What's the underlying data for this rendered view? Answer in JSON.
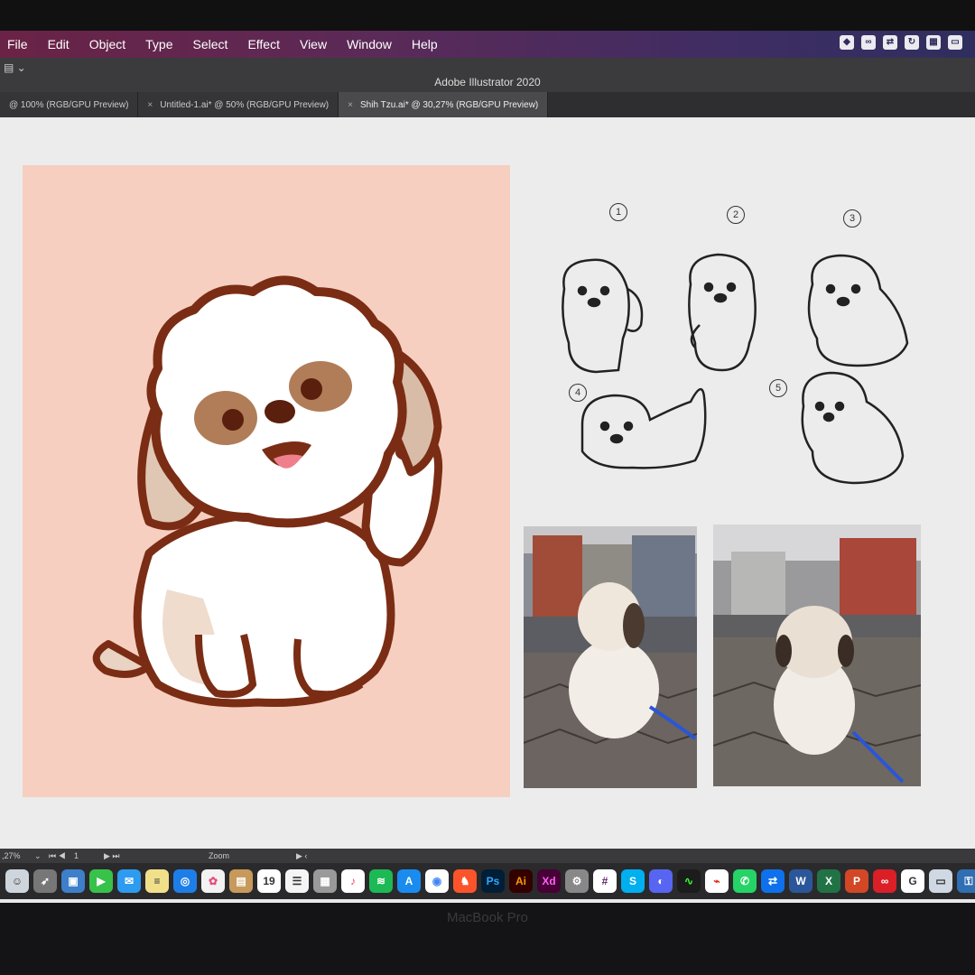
{
  "menu": {
    "items": [
      "File",
      "Edit",
      "Object",
      "Type",
      "Select",
      "Effect",
      "View",
      "Window",
      "Help"
    ],
    "tray_icons": [
      "dropbox-icon",
      "creative-cloud-icon",
      "teamviewer-icon",
      "sync-icon",
      "grid-icon",
      "display-icon"
    ]
  },
  "window": {
    "app_title": "Adobe Illustrator 2020"
  },
  "tabs": [
    {
      "label": "@ 100% (RGB/GPU Preview)",
      "active": false
    },
    {
      "label": "Untitled-1.ai* @ 50% (RGB/GPU Preview)",
      "active": false
    },
    {
      "label": "Shih Tzu.ai* @ 30,27% (RGB/GPU Preview)",
      "active": true
    }
  ],
  "sketches": {
    "numbers": [
      "1",
      "2",
      "3",
      "4",
      "5"
    ]
  },
  "statusbar": {
    "zoom_value": ",27%",
    "page_value": "1",
    "zoom_label": "Zoom"
  },
  "dock": {
    "calendar_day": "19",
    "labels": {
      "ps": "Ps",
      "ai": "Ai",
      "xd": "Xd"
    }
  },
  "device": {
    "brand": "MacBook Pro"
  },
  "colors": {
    "artboard": "#f6cfc0",
    "outline": "#7a2d14",
    "fur": "#ffffff",
    "ai_brand": "#ff9a00"
  }
}
